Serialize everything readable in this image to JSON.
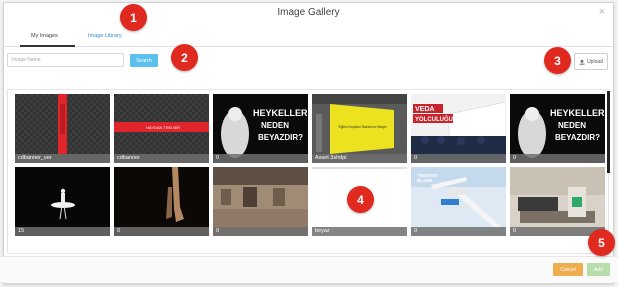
{
  "modal": {
    "title": "Image Gallery",
    "close_glyph": "×"
  },
  "tabs": [
    {
      "label": "My Images",
      "active": true
    },
    {
      "label": "Image Library",
      "active": false
    }
  ],
  "search": {
    "placeholder": "Image Name",
    "button_label": "Search"
  },
  "upload": {
    "label": "Upload",
    "icon": "upload-icon"
  },
  "images": [
    {
      "caption": "cdbanner_ver"
    },
    {
      "caption": "cdbanner"
    },
    {
      "caption": "0"
    },
    {
      "caption": "Asset 3shdpi"
    },
    {
      "caption": "0"
    },
    {
      "caption": "0"
    },
    {
      "caption": "15"
    },
    {
      "caption": "0"
    },
    {
      "caption": "0"
    },
    {
      "caption": "beyaz"
    },
    {
      "caption": "0"
    },
    {
      "caption": "0"
    }
  ],
  "image_text": {
    "heykeller_1": "HEYKELLER",
    "heykeller_2": "NEDEN",
    "heykeller_3": "BEYAZDIR?",
    "veda_1": "VEDA",
    "veda_2": "YOLCULUĞU",
    "tweed_1": "TWISTED",
    "tweed_2": "BLADE",
    "yellow_text": "'Eğitim Koşulları' Bakımına Hikaye",
    "cd_banner_text": "HAYDAN TEKİ BİR"
  },
  "footer": {
    "cancel_label": "Cancel",
    "add_label": "Add"
  },
  "markers": [
    "1",
    "2",
    "3",
    "4",
    "5"
  ],
  "colors": {
    "accent_blue": "#5bc0eb",
    "link_blue": "#2f8fd1",
    "cancel_orange": "#f0ad4e",
    "add_green_disabled": "#b7dda8",
    "marker_red": "#e0291f"
  }
}
